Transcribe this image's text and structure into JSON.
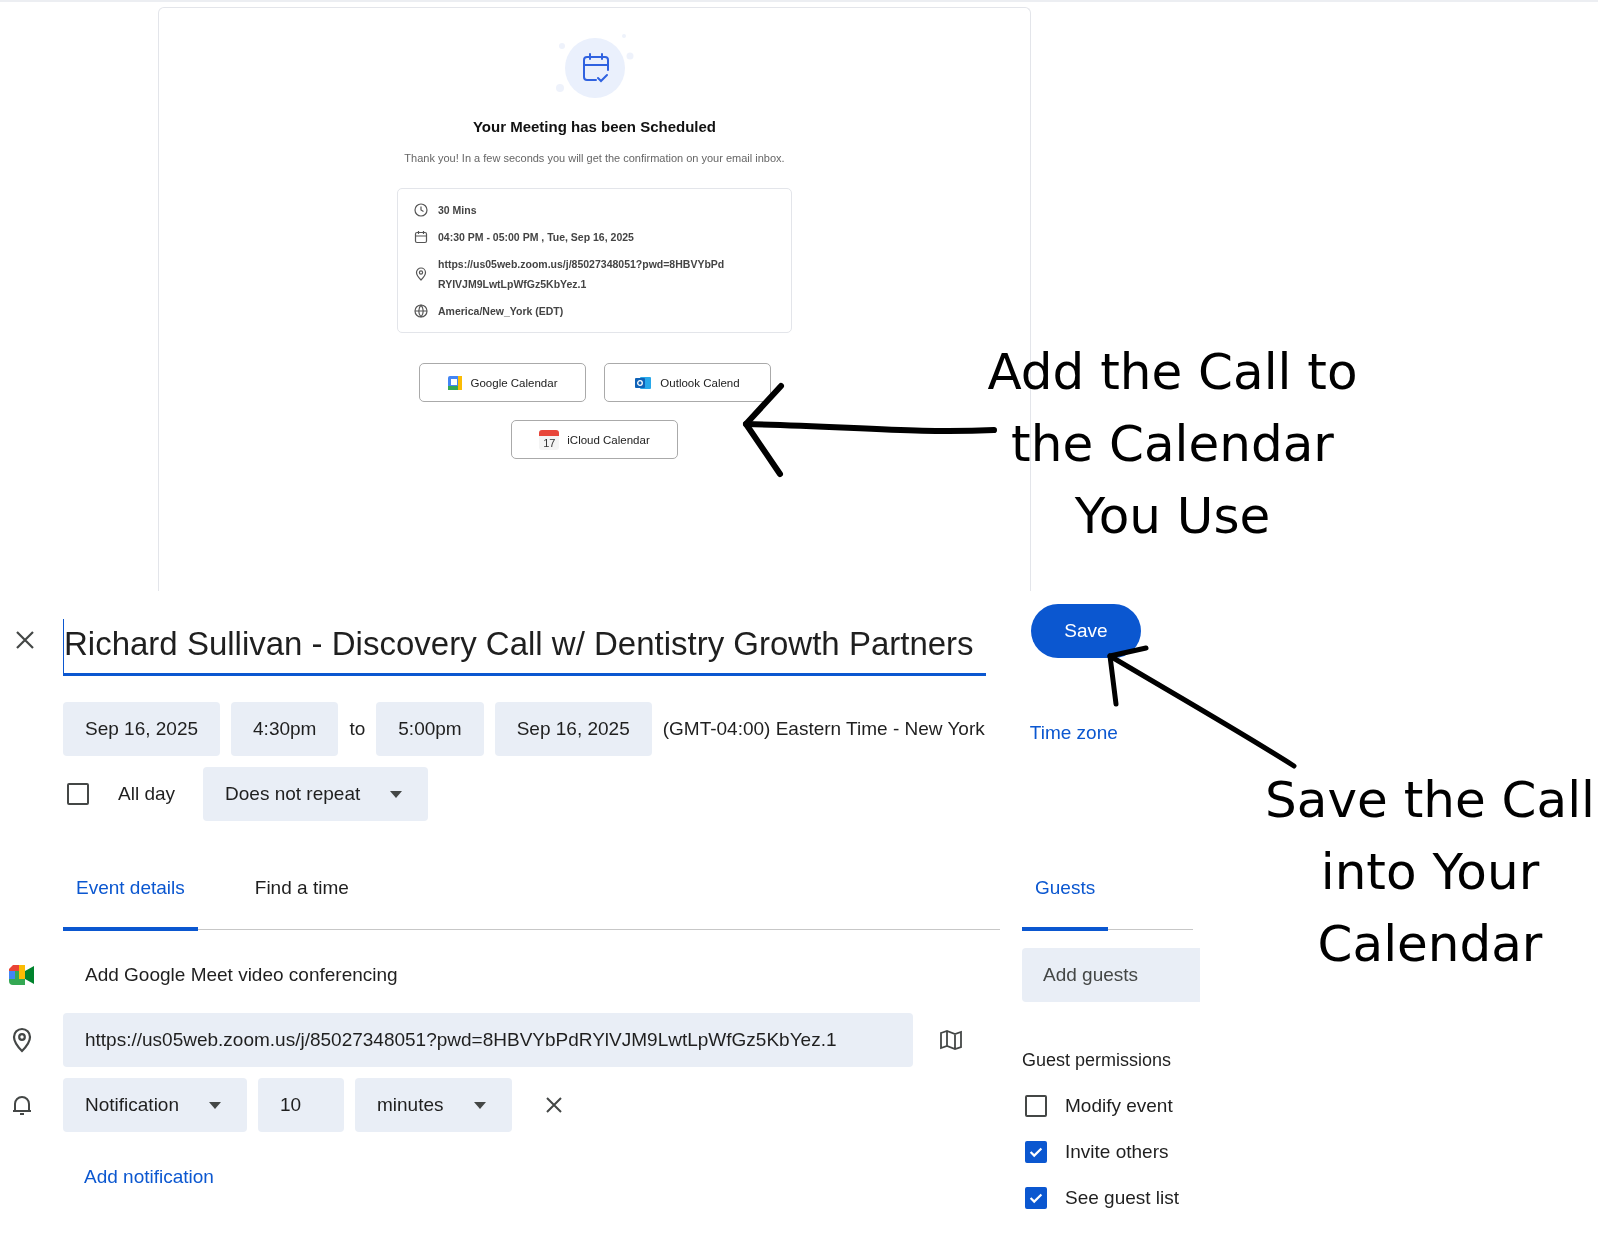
{
  "confirmation": {
    "title": "Your Meeting has been Scheduled",
    "message": "Thank you! In a few seconds you will get the confirmation on your email inbox.",
    "details": [
      {
        "kind": "duration",
        "text": "30 Mins"
      },
      {
        "kind": "date",
        "text": "04:30 PM - 05:00 PM , Tue, Sep 16, 2025"
      },
      {
        "kind": "location",
        "text": "https://us05web.zoom.us/j/85027348051?pwd=8HBVYbPd RYIVJM9LwtLpWfGz5KbYez.1"
      },
      {
        "kind": "timezone",
        "text": "America/New_York (EDT)"
      }
    ],
    "buttons": [
      {
        "kind": "google",
        "label": "Google Calendar"
      },
      {
        "kind": "outlook",
        "label": "Outlook Calend"
      },
      {
        "kind": "icloud",
        "label": "iCloud Calendar",
        "icon_text": "17"
      }
    ]
  },
  "annotations": [
    {
      "lines": [
        "Add the Call to",
        "the Calendar",
        "You Use"
      ]
    },
    {
      "lines": [
        "Save the Call",
        "into Your",
        "Calendar"
      ]
    }
  ],
  "event": {
    "title": "Richard Sullivan - Discovery Call w/ Dentistry Growth Partners",
    "save": "Save",
    "start_date": "Sep 16, 2025",
    "start_time": "4:30pm",
    "to": "to",
    "end_time": "5:00pm",
    "end_date": "Sep 16, 2025",
    "timezone": "(GMT-04:00) Eastern Time - New York",
    "timezone_link": "Time zone",
    "all_day": {
      "label": "All day",
      "checked": false
    },
    "repeat": "Does not repeat",
    "tabs": [
      {
        "label": "Event details",
        "selected": true
      },
      {
        "label": "Find a time",
        "selected": false
      }
    ],
    "conferencing": "Add Google Meet video conferencing",
    "location": "https://us05web.zoom.us/j/85027348051?pwd=8HBVYbPdRYlVJM9LwtLpWfGz5KbYez.1",
    "notification": {
      "type": "Notification",
      "amount": "10",
      "unit": "minutes"
    },
    "add_notification": "Add notification",
    "guests_tab": {
      "label": "Guests",
      "selected": true
    },
    "add_guests": {
      "placeholder": "Add guests"
    },
    "permissions_title": "Guest permissions",
    "permissions": [
      {
        "label": "Modify event",
        "checked": false
      },
      {
        "label": "Invite others",
        "checked": true
      },
      {
        "label": "See guest list",
        "checked": true
      }
    ]
  }
}
